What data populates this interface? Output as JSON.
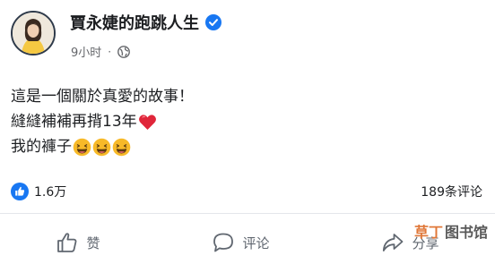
{
  "post": {
    "author": "賈永婕的跑跳人生",
    "time": "9小时",
    "separator": "·",
    "lines": [
      "這是一個關於真愛的故事！",
      "縫縫補補再揹13年",
      "我的褲子"
    ]
  },
  "stats": {
    "reactions": "1.6万",
    "comments": "189条评论"
  },
  "actions": {
    "like": "赞",
    "comment": "评论",
    "share": "分享"
  },
  "watermark": {
    "brand": "草丁",
    "text": "图书馆"
  },
  "icons": {
    "verified": "verified-badge-icon",
    "audience": "globe-icon",
    "heart": "red-heart-emoji",
    "laugh": "laughing-emoji",
    "like_badge": "thumbs-up-reaction-icon"
  },
  "colors": {
    "brand_blue": "#1877f2",
    "text": "#1c1e21",
    "muted": "#65676b",
    "heart": "#e0263a",
    "emoji": "#f7b928"
  }
}
